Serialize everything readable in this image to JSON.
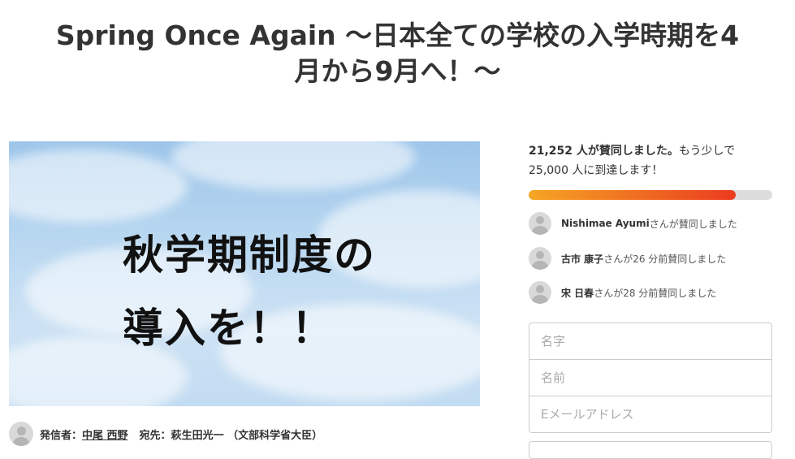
{
  "page": {
    "title_line1": "Spring Once Again ～日本全ての学校の入学時期を4",
    "title_line2": "月から9月へ！～"
  },
  "hero": {
    "line1": "秋学期制度の",
    "line2": "導入を！！"
  },
  "creator": {
    "sender_label": "発信者：",
    "sender_name": "中尾 西野",
    "recipient_label": "宛先：",
    "recipient_name": "萩生田光一 （文部科学省大臣）"
  },
  "signatures": {
    "count": "21,252 人が賛同しました。",
    "goal_text_1": "もう少しで",
    "goal_text_2": "25,000 人に到達します！",
    "progress_fraction": 0.85,
    "accent_start": "#f5a623",
    "accent_end": "#ec3b1f"
  },
  "recent_signers": [
    {
      "name": "Nishimae Ayumi",
      "text": "さんが賛同しました"
    },
    {
      "name": "古市 康子",
      "text": "さんが26 分前賛同しました"
    },
    {
      "name": "宋 日春",
      "text": "さんが28 分前賛同しました"
    }
  ],
  "form": {
    "last_name_placeholder": "名字",
    "first_name_placeholder": "名前",
    "email_placeholder": "Eメールアドレス"
  }
}
